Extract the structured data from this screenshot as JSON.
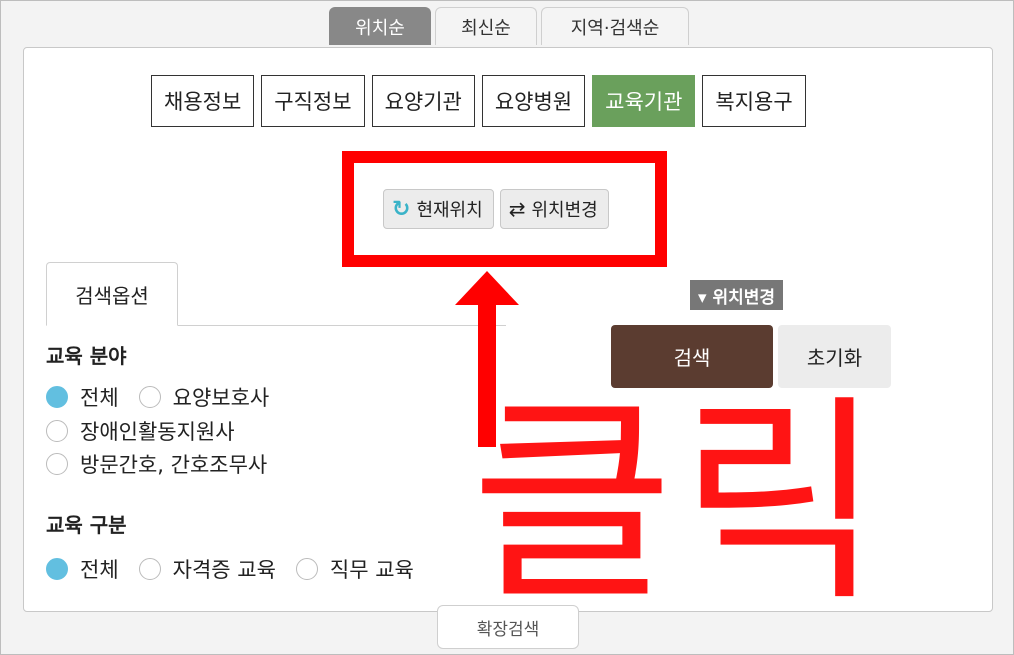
{
  "top_tabs": [
    {
      "label": "위치순",
      "active": true
    },
    {
      "label": "최신순",
      "active": false
    },
    {
      "label": "지역·검색순",
      "active": false
    }
  ],
  "categories": [
    {
      "label": "채용정보",
      "active": false
    },
    {
      "label": "구직정보",
      "active": false
    },
    {
      "label": "요양기관",
      "active": false
    },
    {
      "label": "요양병원",
      "active": false
    },
    {
      "label": "교육기관",
      "active": true
    },
    {
      "label": "복지용구",
      "active": false
    }
  ],
  "location": {
    "current_label": "현재위치",
    "change_label": "위치변경",
    "current_icon": "refresh-icon",
    "change_icon": "swap-icon"
  },
  "options_tab": "검색옵션",
  "education_field": {
    "title": "교육 분야",
    "options": [
      {
        "label": "전체",
        "selected": true
      },
      {
        "label": "요양보호사",
        "selected": false
      },
      {
        "label": "장애인활동지원사",
        "selected": false
      },
      {
        "label": "방문간호, 간호조무사",
        "selected": false
      }
    ]
  },
  "education_type": {
    "title": "교육 구분",
    "options": [
      {
        "label": "전체",
        "selected": true
      },
      {
        "label": "자격증 교육",
        "selected": false
      },
      {
        "label": "직무 교육",
        "selected": false
      }
    ]
  },
  "location_change_tag": "▾ 위치변경",
  "search_button": "검색",
  "reset_button": "초기화",
  "expand_button": "확장검색",
  "annotation": {
    "text": "클릭",
    "color": "#ff0000"
  },
  "colors": {
    "active_category": "#6aa05c",
    "search_button": "#5b3c30",
    "radio_selected": "#62bfe0"
  }
}
